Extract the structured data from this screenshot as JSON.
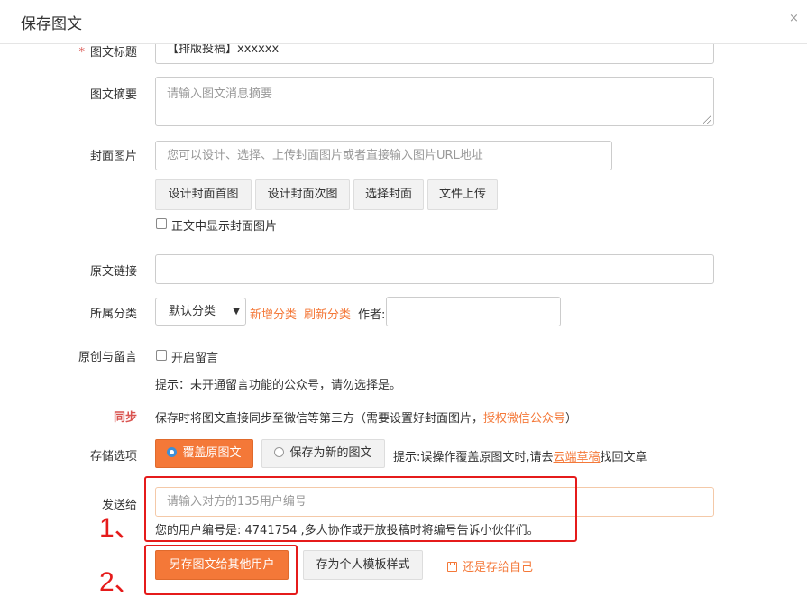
{
  "dialog": {
    "title": "保存图文",
    "close_glyph": "×"
  },
  "form": {
    "title_field": {
      "label": "图文标题",
      "value": "【排版投稿】xxxxxx"
    },
    "summary": {
      "label": "图文摘要",
      "placeholder": "请输入图文消息摘要"
    },
    "cover": {
      "label": "封面图片",
      "placeholder": "您可以设计、选择、上传封面图片或者直接输入图片URL地址",
      "buttons": [
        "设计封面首图",
        "设计封面次图",
        "选择封面",
        "文件上传"
      ],
      "show_in_body_label": "正文中显示封面图片"
    },
    "source_link": {
      "label": "原文链接",
      "value": ""
    },
    "category": {
      "label": "所属分类",
      "selected": "默认分类",
      "add_link": "新增分类",
      "refresh_link": "刷新分类",
      "author_label": "作者:"
    },
    "comment": {
      "label": "原创与留言",
      "enable_label": "开启留言",
      "hint": "提示：未开通留言功能的公众号，请勿选择是。"
    },
    "sync": {
      "label": "同步",
      "text_before": "保存时将图文直接同步至微信等第三方（需要设置好封面图片，",
      "link": "授权微信公众号",
      "text_after": "）"
    },
    "storage": {
      "label": "存储选项",
      "option_overwrite": "覆盖原图文",
      "option_new": "保存为新的图文",
      "hint_before": "提示:误操作覆盖原图文时,请去",
      "hint_link": "云端草稿",
      "hint_after": "找回文章"
    },
    "send_to": {
      "label": "发送给",
      "placeholder": "请输入对方的135用户编号",
      "note": "您的用户编号是: 4741754 ,多人协作或开放投稿时将编号告诉小伙伴们。"
    },
    "actions": {
      "save_to_other": "另存图文给其他用户",
      "save_template": "存为个人模板样式",
      "save_self": "还是存给自己"
    }
  },
  "annotations": {
    "one": "1、",
    "two": "2、"
  },
  "colors": {
    "accent": "#f47838",
    "annotation_red": "#e51b1b",
    "required_red": "#d9534f"
  }
}
